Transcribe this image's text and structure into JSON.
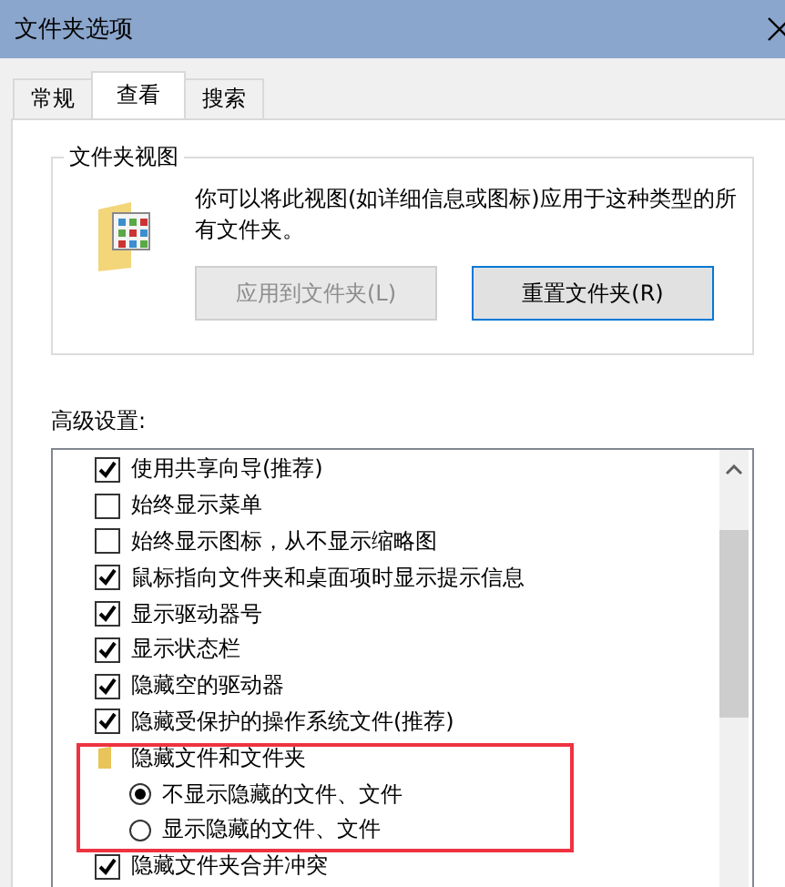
{
  "window": {
    "title": "文件夹选项"
  },
  "tabs": [
    {
      "label": "常规",
      "selected": false
    },
    {
      "label": "查看",
      "selected": true
    },
    {
      "label": "搜索",
      "selected": false
    }
  ],
  "folder_views": {
    "title": "文件夹视图",
    "description": "你可以将此视图(如详细信息或图标)应用于这种类型的所有文件夹。",
    "buttons": [
      {
        "label": "应用到文件夹(L)",
        "disabled": true
      },
      {
        "label": "重置文件夹(R)",
        "disabled": false
      }
    ]
  },
  "advanced": {
    "label": "高级设置:",
    "items": [
      {
        "kind": "checkbox",
        "label": "使用共享向导(推荐)",
        "checked": true
      },
      {
        "kind": "checkbox",
        "label": "始终显示菜单",
        "checked": false
      },
      {
        "kind": "checkbox",
        "label": "始终显示图标，从不显示缩略图",
        "checked": false
      },
      {
        "kind": "checkbox",
        "label": "鼠标指向文件夹和桌面项时显示提示信息",
        "checked": true
      },
      {
        "kind": "checkbox",
        "label": "显示驱动器号",
        "checked": true
      },
      {
        "kind": "checkbox",
        "label": "显示状态栏",
        "checked": true
      },
      {
        "kind": "checkbox",
        "label": "隐藏空的驱动器",
        "checked": true
      },
      {
        "kind": "checkbox",
        "label": "隐藏受保护的操作系统文件(推荐)",
        "checked": true
      },
      {
        "kind": "folder",
        "label": "隐藏文件和文件夹",
        "highlighted": true,
        "children": [
          {
            "label": "不显示隐藏的文件、文件",
            "selected": true
          },
          {
            "label": "显示隐藏的文件、文件",
            "selected": false
          }
        ]
      },
      {
        "kind": "checkbox",
        "label": "隐藏文件夹合并冲突",
        "checked": true
      }
    ]
  }
}
